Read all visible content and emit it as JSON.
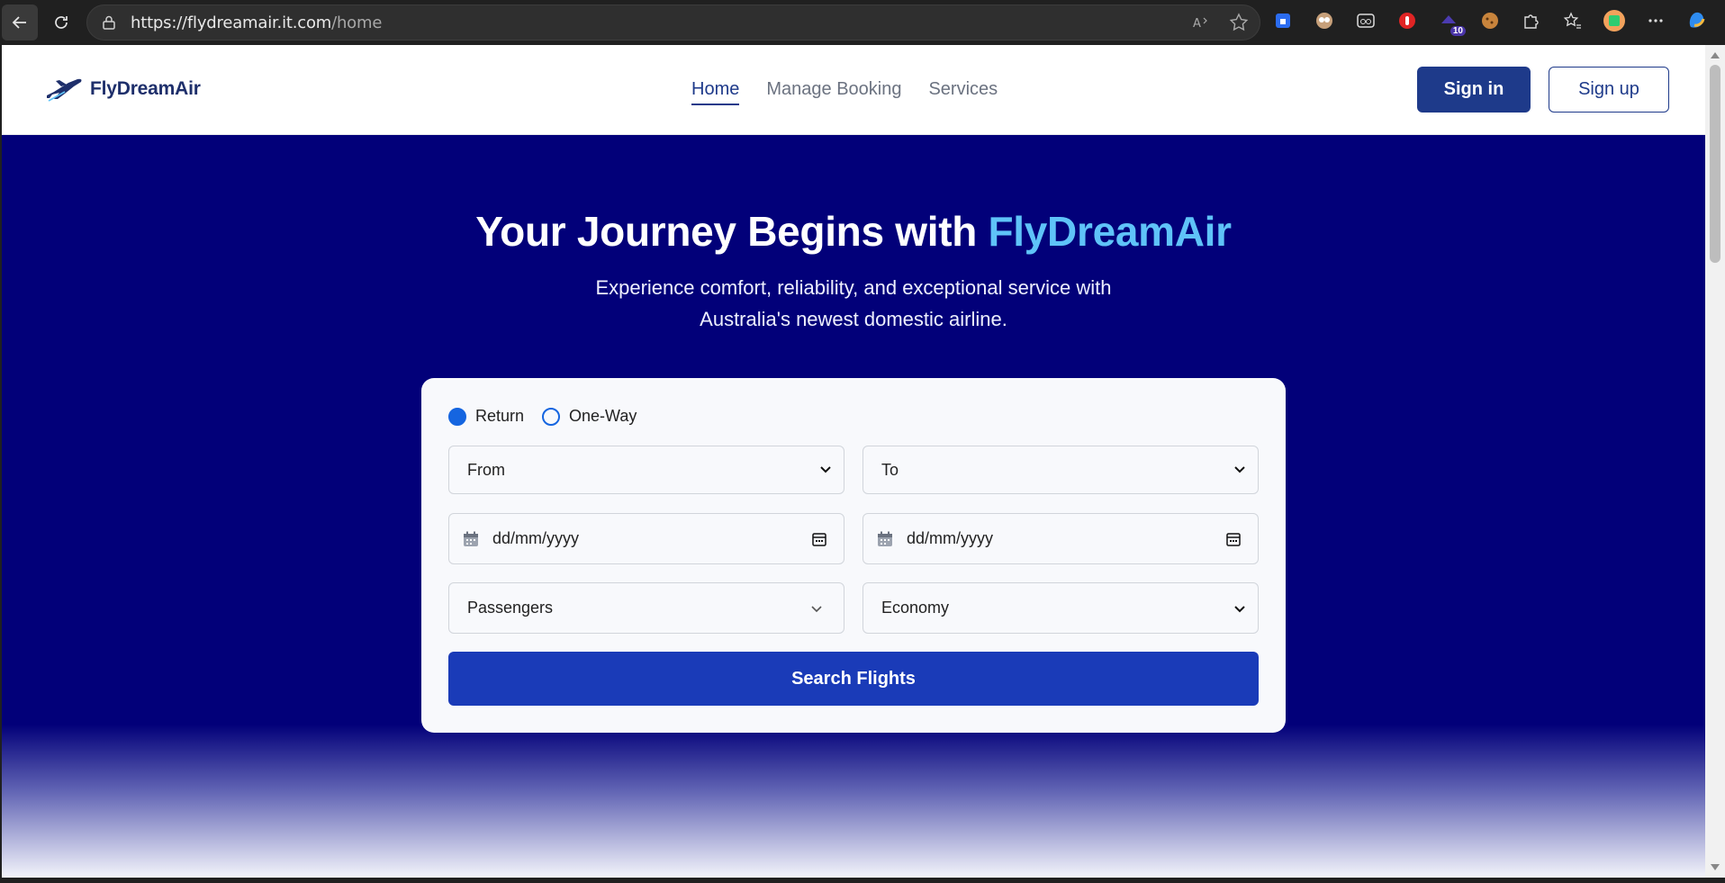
{
  "browser": {
    "url_host": "https://flydreamair.it.com",
    "url_path": "/home",
    "extension_badge": "10"
  },
  "header": {
    "logo_text": "FlyDreamAir",
    "nav": [
      {
        "label": "Home",
        "active": true
      },
      {
        "label": "Manage Booking",
        "active": false
      },
      {
        "label": "Services",
        "active": false
      }
    ],
    "signin_label": "Sign in",
    "signup_label": "Sign up"
  },
  "hero": {
    "title_prefix": "Your Journey Begins with ",
    "title_accent": "FlyDreamAir",
    "subtitle_line1": "Experience comfort, reliability, and exceptional service with",
    "subtitle_line2": "Australia's newest domestic airline."
  },
  "search": {
    "trip_types": [
      {
        "label": "Return",
        "selected": true
      },
      {
        "label": "One-Way",
        "selected": false
      }
    ],
    "from_label": "From",
    "to_label": "To",
    "depart_date_placeholder": "dd/mm/yyyy",
    "return_date_placeholder": "dd/mm/yyyy",
    "passengers_label": "Passengers",
    "class_label": "Economy",
    "submit_label": "Search Flights"
  },
  "colors": {
    "hero_bg": "#020079",
    "brand_navy": "#1e3a8a",
    "accent_sky": "#5fc3f8",
    "search_button": "#1a3bb8",
    "radio_blue": "#1565e0"
  }
}
